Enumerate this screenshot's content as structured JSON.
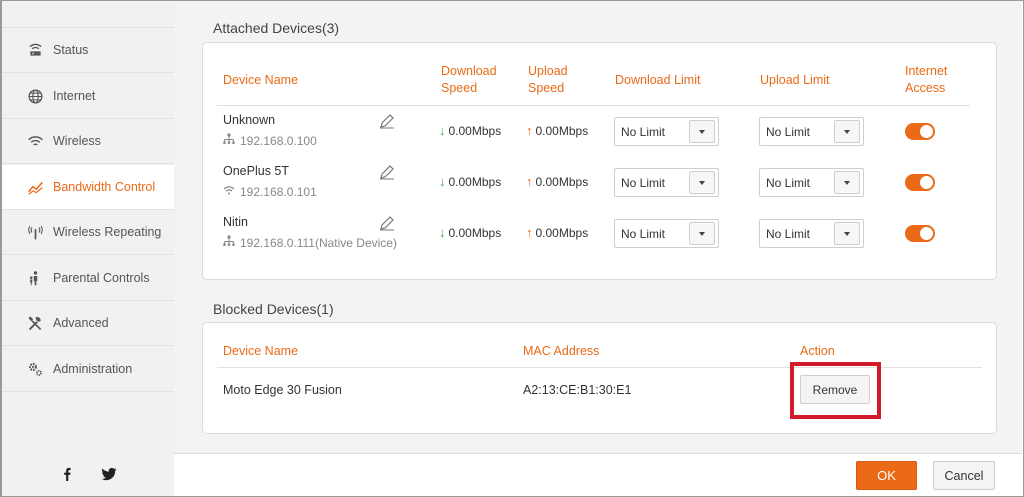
{
  "sidebar": {
    "items": [
      {
        "label": "Status",
        "icon": "router-icon",
        "active": false
      },
      {
        "label": "Internet",
        "icon": "globe-icon",
        "active": false
      },
      {
        "label": "Wireless",
        "icon": "wifi-icon",
        "active": false
      },
      {
        "label": "Bandwidth Control",
        "icon": "bandwidth-icon",
        "active": true
      },
      {
        "label": "Wireless Repeating",
        "icon": "antenna-icon",
        "active": false
      },
      {
        "label": "Parental Controls",
        "icon": "parent-child-icon",
        "active": false
      },
      {
        "label": "Advanced",
        "icon": "tools-icon",
        "active": false
      },
      {
        "label": "Administration",
        "icon": "gears-icon",
        "active": false
      }
    ],
    "social": [
      "facebook-icon",
      "twitter-icon"
    ]
  },
  "attached": {
    "title": "Attached Devices(3)",
    "headers": {
      "device_name": "Device Name",
      "download_speed_1": "Download",
      "download_speed_2": "Speed",
      "upload_speed_1": "Upload",
      "upload_speed_2": "Speed",
      "download_limit": "Download Limit",
      "upload_limit": "Upload Limit",
      "internet_access_1": "Internet",
      "internet_access_2": "Access"
    },
    "devices": [
      {
        "name": "Unknown",
        "ip": "192.168.0.100",
        "conn_icon": "wired-network-icon",
        "download": "0.00Mbps",
        "upload": "0.00Mbps",
        "download_limit": "No Limit",
        "upload_limit": "No Limit",
        "internet_access": true
      },
      {
        "name": "OnePlus 5T",
        "ip": "192.168.0.101",
        "conn_icon": "wifi-icon",
        "download": "0.00Mbps",
        "upload": "0.00Mbps",
        "download_limit": "No Limit",
        "upload_limit": "No Limit",
        "internet_access": true
      },
      {
        "name": "Nitin",
        "ip": "192.168.0.111(Native Device)",
        "conn_icon": "wired-network-icon",
        "download": "0.00Mbps",
        "upload": "0.00Mbps",
        "download_limit": "No Limit",
        "upload_limit": "No Limit",
        "internet_access": true
      }
    ]
  },
  "blocked": {
    "title": "Blocked Devices(1)",
    "headers": {
      "device_name": "Device Name",
      "mac": "MAC Address",
      "action": "Action"
    },
    "devices": [
      {
        "name": "Moto Edge 30 Fusion",
        "mac": "A2:13:CE:B1:30:E1",
        "action_label": "Remove"
      }
    ]
  },
  "footer": {
    "ok_label": "OK",
    "cancel_label": "Cancel"
  },
  "colors": {
    "accent": "#ea6a17",
    "highlight": "#d11a2a",
    "download_arrow": "#3aa84b"
  }
}
